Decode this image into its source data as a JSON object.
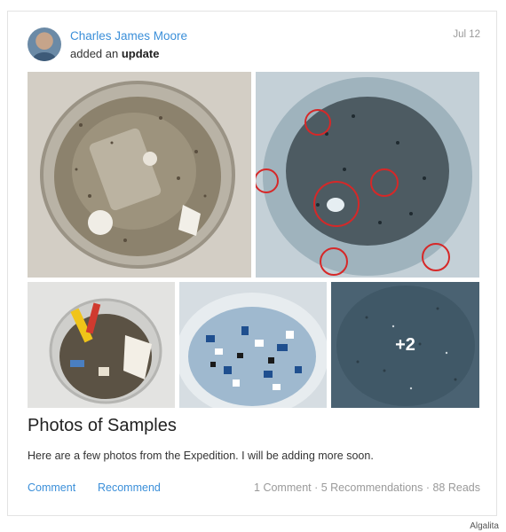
{
  "post": {
    "author": "Charles James Moore",
    "action_prefix": "added an",
    "action_emphasis": "update",
    "date": "Jul 12",
    "title": "Photos of Samples",
    "body": "Here are a few photos from the Expedition. I will be adding more soon.",
    "more_photos_label": "+2"
  },
  "actions": {
    "comment_label": "Comment",
    "recommend_label": "Recommend"
  },
  "stats": {
    "summary": "1 Comment · 5 Recommendations · 88 Reads"
  },
  "credit": "Algalita",
  "colors": {
    "link": "#3b8fd9",
    "muted": "#9a9a9a",
    "annotation_circle": "#d62828"
  }
}
